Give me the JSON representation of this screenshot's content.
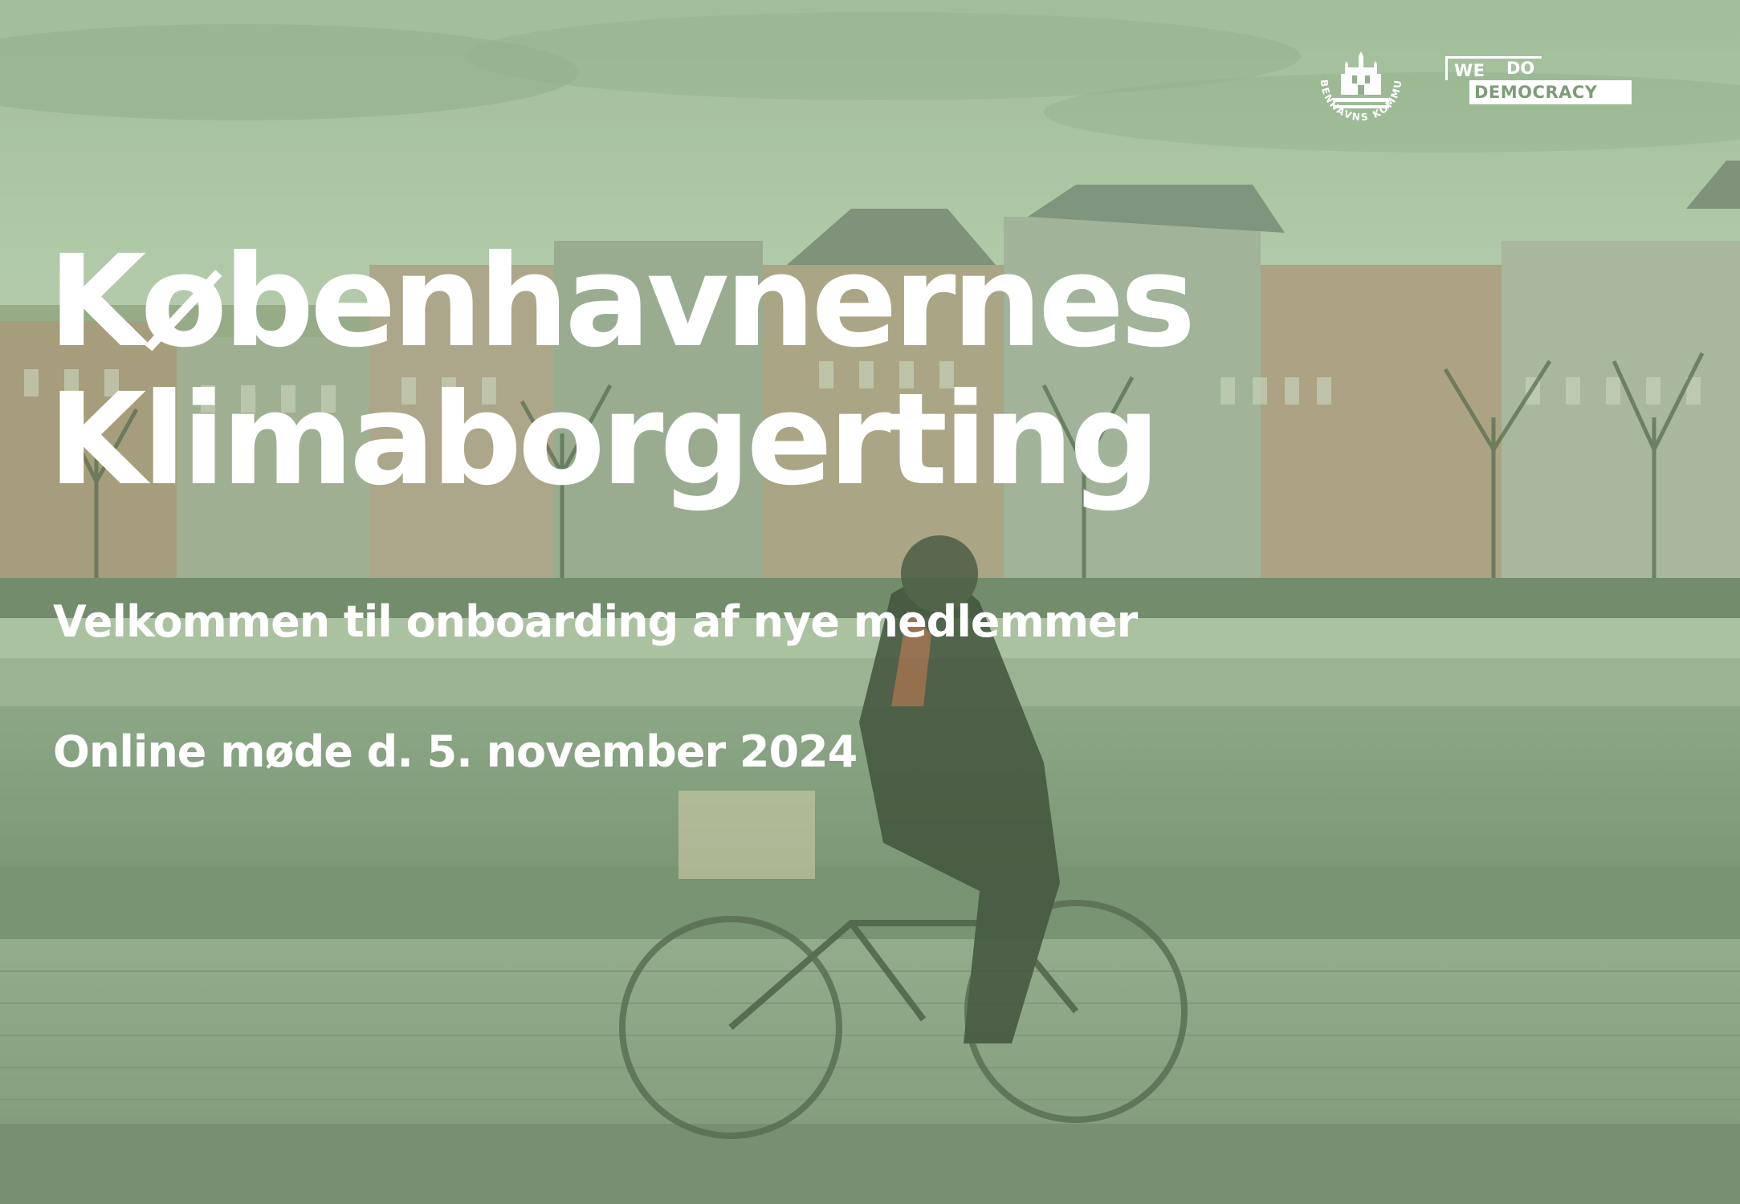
{
  "slide": {
    "title_line1": "Københavnernes",
    "title_line2": "Klimaborgerting",
    "subtitle": "Velkommen til onboarding af nye medlemmer",
    "meeting": "Online møde d. 5. november 2024"
  },
  "logos": {
    "kk_text": "KØBENHAVNS KOMMUNE",
    "wdd_line1": "WE",
    "wdd_do": "DO",
    "wdd_line2": "DEMOCRACY"
  },
  "colors": {
    "tint": "#8fb08a",
    "text": "#ffffff"
  }
}
